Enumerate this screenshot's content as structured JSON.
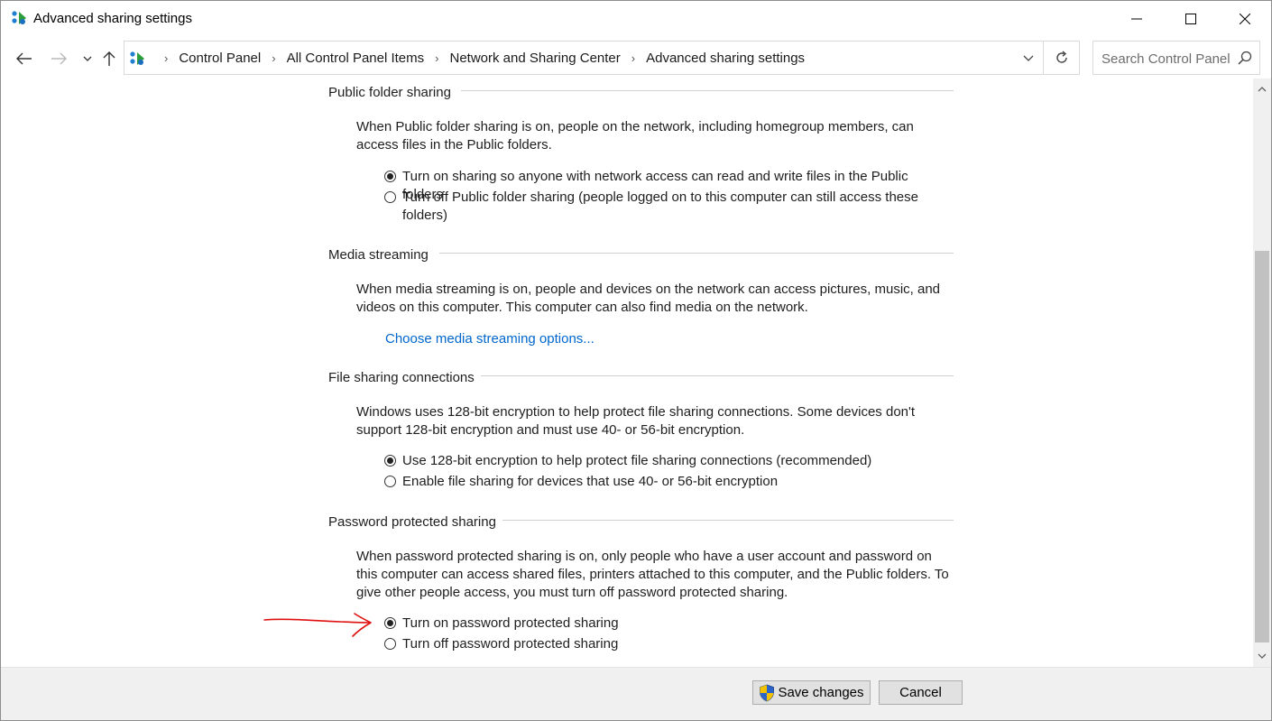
{
  "window": {
    "title": "Advanced sharing settings"
  },
  "address": {
    "breadcrumbs": [
      "Control Panel",
      "All Control Panel Items",
      "Network and Sharing Center",
      "Advanced sharing settings"
    ],
    "search_placeholder": "Search Control Panel"
  },
  "sections": {
    "public_folder": {
      "heading": "Public folder sharing",
      "description": "When Public folder sharing is on, people on the network, including homegroup members, can access files in the Public folders.",
      "options": [
        {
          "label": "Turn on sharing so anyone with network access can read and write files in the Public folders",
          "checked": true
        },
        {
          "label": "Turn off Public folder sharing (people logged on to this computer can still access these folders)",
          "checked": false
        }
      ]
    },
    "media_streaming": {
      "heading": "Media streaming",
      "description": "When media streaming is on, people and devices on the network can access pictures, music, and videos on this computer. This computer can also find media on the network.",
      "link": "Choose media streaming options..."
    },
    "file_sharing": {
      "heading": "File sharing connections",
      "description": "Windows uses 128-bit encryption to help protect file sharing connections. Some devices don't support 128-bit encryption and must use 40- or 56-bit encryption.",
      "options": [
        {
          "label": "Use 128-bit encryption to help protect file sharing connections (recommended)",
          "checked": true
        },
        {
          "label": "Enable file sharing for devices that use 40- or 56-bit encryption",
          "checked": false
        }
      ]
    },
    "password": {
      "heading": "Password protected sharing",
      "description": "When password protected sharing is on, only people who have a user account and password on this computer can access shared files, printers attached to this computer, and the Public folders. To give other people access, you must turn off password protected sharing.",
      "options": [
        {
          "label": "Turn on password protected sharing",
          "checked": true
        },
        {
          "label": "Turn off password protected sharing",
          "checked": false
        }
      ]
    }
  },
  "footer": {
    "save_label": "Save changes",
    "cancel_label": "Cancel"
  },
  "colors": {
    "link": "#0066cc",
    "annotation": "#e01010",
    "footer_bg": "#f0f0f0"
  },
  "icons": [
    "network-icon",
    "minimize-icon",
    "maximize-icon",
    "close-icon",
    "back-arrow-icon",
    "forward-arrow-icon",
    "chevron-down-icon",
    "up-arrow-icon",
    "refresh-icon",
    "search-icon",
    "shield-icon"
  ]
}
